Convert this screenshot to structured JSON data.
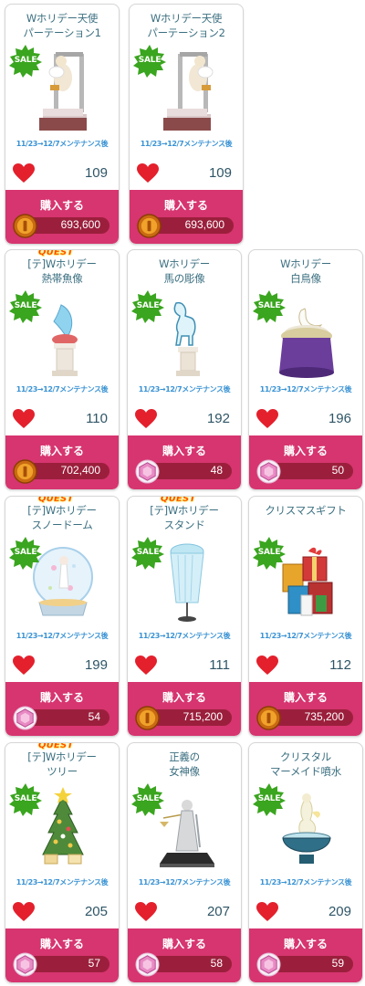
{
  "items": [
    {
      "title": "Wホリデー天使\nパーテーション1",
      "quest": "",
      "sale": "SALE",
      "maintenance": "11/23→12/7メンテナンス後",
      "likes": "109",
      "buy_label": "購入する",
      "price": "693,600",
      "currency": "coin-icon",
      "art": "statue-partition"
    },
    {
      "title": "Wホリデー天使\nパーテーション2",
      "quest": "",
      "sale": "SALE",
      "maintenance": "11/23→12/7メンテナンス後",
      "likes": "109",
      "buy_label": "購入する",
      "price": "693,600",
      "currency": "coin-icon",
      "art": "statue-partition"
    },
    {
      "title": "[テ]Wホリデー\n熱帯魚像",
      "quest": "QUEST",
      "sale": "SALE",
      "maintenance": "11/23→12/7メンテナンス後",
      "likes": "110",
      "buy_label": "購入する",
      "price": "702,400",
      "currency": "coin-icon",
      "art": "fish-statue"
    },
    {
      "title": "Wホリデー\n馬の彫像",
      "quest": "",
      "sale": "SALE",
      "maintenance": "11/23→12/7メンテナンス後",
      "likes": "192",
      "buy_label": "購入する",
      "price": "48",
      "currency": "gem-icon",
      "art": "horse-statue"
    },
    {
      "title": "Wホリデー\n白鳥像",
      "quest": "",
      "sale": "SALE",
      "maintenance": "11/23→12/7メンテナンス後",
      "likes": "196",
      "buy_label": "購入する",
      "price": "50",
      "currency": "gem-icon",
      "art": "swan-statue"
    },
    {
      "title": "[テ]Wホリデー\nスノードーム",
      "quest": "QUEST",
      "sale": "SALE",
      "maintenance": "11/23→12/7メンテナンス後",
      "likes": "199",
      "buy_label": "購入する",
      "price": "54",
      "currency": "gem-icon",
      "art": "snow-globe"
    },
    {
      "title": "[テ]Wホリデー\nスタンド",
      "quest": "QUEST",
      "sale": "SALE",
      "maintenance": "11/23→12/7メンテナンス後",
      "likes": "111",
      "buy_label": "購入する",
      "price": "715,200",
      "currency": "coin-icon",
      "art": "crystal-stand"
    },
    {
      "title": "クリスマスギフト",
      "quest": "",
      "sale": "SALE",
      "maintenance": "11/23→12/7メンテナンス後",
      "likes": "112",
      "buy_label": "購入する",
      "price": "735,200",
      "currency": "coin-icon",
      "art": "gift-pile"
    },
    {
      "title": "[テ]Wホリデー\nツリー",
      "quest": "QUEST",
      "sale": "SALE",
      "maintenance": "11/23→12/7メンテナンス後",
      "likes": "205",
      "buy_label": "購入する",
      "price": "57",
      "currency": "gem-icon",
      "art": "christmas-tree"
    },
    {
      "title": "正義の\n女神像",
      "quest": "",
      "sale": "SALE",
      "maintenance": "11/23→12/7メンテナンス後",
      "likes": "207",
      "buy_label": "購入する",
      "price": "58",
      "currency": "gem-icon",
      "art": "justice-statue"
    },
    {
      "title": "クリスタル\nマーメイド噴水",
      "quest": "",
      "sale": "SALE",
      "maintenance": "11/23→12/7メンテナンス後",
      "likes": "209",
      "buy_label": "購入する",
      "price": "59",
      "currency": "gem-icon",
      "art": "mermaid-fountain"
    }
  ],
  "colors": {
    "title": "#3b6f80",
    "maintenance": "#3a93d4",
    "buy_bg": "#d6356f",
    "price_bar": "#9b1f3c",
    "heart": "#e3202c",
    "sale_badge": "#3aa51f",
    "quest": "#ff3b18"
  }
}
